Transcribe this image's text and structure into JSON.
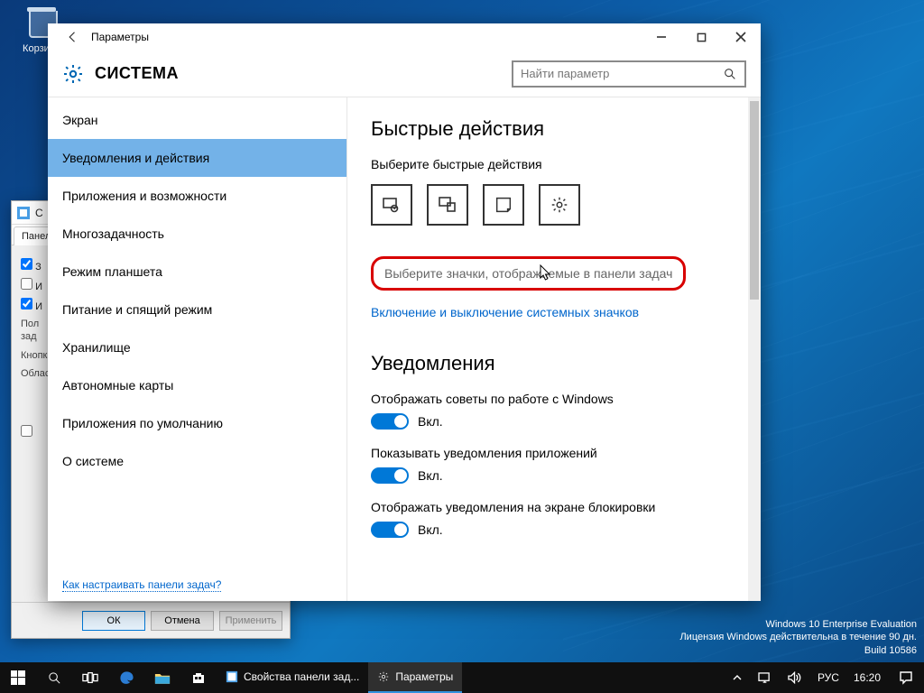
{
  "desktop": {
    "recycle_bin_label": "Корзина"
  },
  "bg_window": {
    "title": "Свойства панели задач и меню \"Пуск\"",
    "tab_label": "Панель задач",
    "check1": "З",
    "check2": "И",
    "check3": "И",
    "txt_pos": "Положение",
    "txt_knop": "Кнопки",
    "txt_obl": "Область",
    "btn_ok": "ОК",
    "btn_cancel": "Отмена",
    "btn_apply": "Применить"
  },
  "settings": {
    "window_title": "Параметры",
    "section": "СИСТЕМА",
    "search_placeholder": "Найти параметр",
    "sidebar": [
      "Экран",
      "Уведомления и действия",
      "Приложения и возможности",
      "Многозадачность",
      "Режим планшета",
      "Питание и спящий режим",
      "Хранилище",
      "Автономные карты",
      "Приложения по умолчанию",
      "О системе"
    ],
    "sidebar_selected_index": 1,
    "help_link": "Как настраивать панели задач?",
    "main": {
      "qa_heading": "Быстрые действия",
      "qa_sub": "Выберите быстрые действия",
      "link_highlight": "Выберите значки, отображаемые в панели задач",
      "link_sys_icons": "Включение и выключение системных значков",
      "notify_heading": "Уведомления",
      "toggles": [
        {
          "label": "Отображать советы по работе с Windows",
          "state": "Вкл."
        },
        {
          "label": "Показывать уведомления приложений",
          "state": "Вкл."
        },
        {
          "label": "Отображать уведомления на экране блокировки",
          "state": "Вкл."
        }
      ]
    }
  },
  "watermark": {
    "line1": "Windows 10 Enterprise Evaluation",
    "line2": "Лицензия Windows действительна в течение 90 дн.",
    "line3": "Build 10586"
  },
  "taskbar": {
    "task1": "Свойства панели зад...",
    "task2": "Параметры",
    "lang": "РУС",
    "clock": "16:20"
  }
}
